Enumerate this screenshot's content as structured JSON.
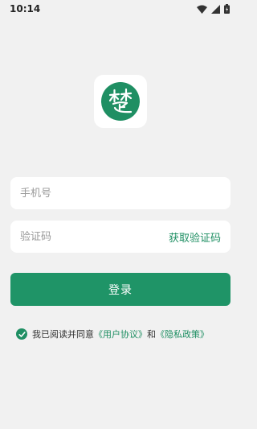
{
  "status_bar": {
    "time": "10:14"
  },
  "colors": {
    "accent": "#1f9467",
    "background": "#f1f1f1",
    "field_bg": "#ffffff"
  },
  "logo": {
    "glyph": "楚",
    "icon": "app-logo-icon"
  },
  "form": {
    "phone_placeholder": "手机号",
    "code_placeholder": "验证码",
    "get_code_label": "获取验证码",
    "login_label": "登录"
  },
  "agreement": {
    "checked": true,
    "prefix": "我已阅读并同意",
    "user_agreement": "《用户协议》",
    "conjunction": "和",
    "privacy_policy": "《隐私政策》"
  }
}
